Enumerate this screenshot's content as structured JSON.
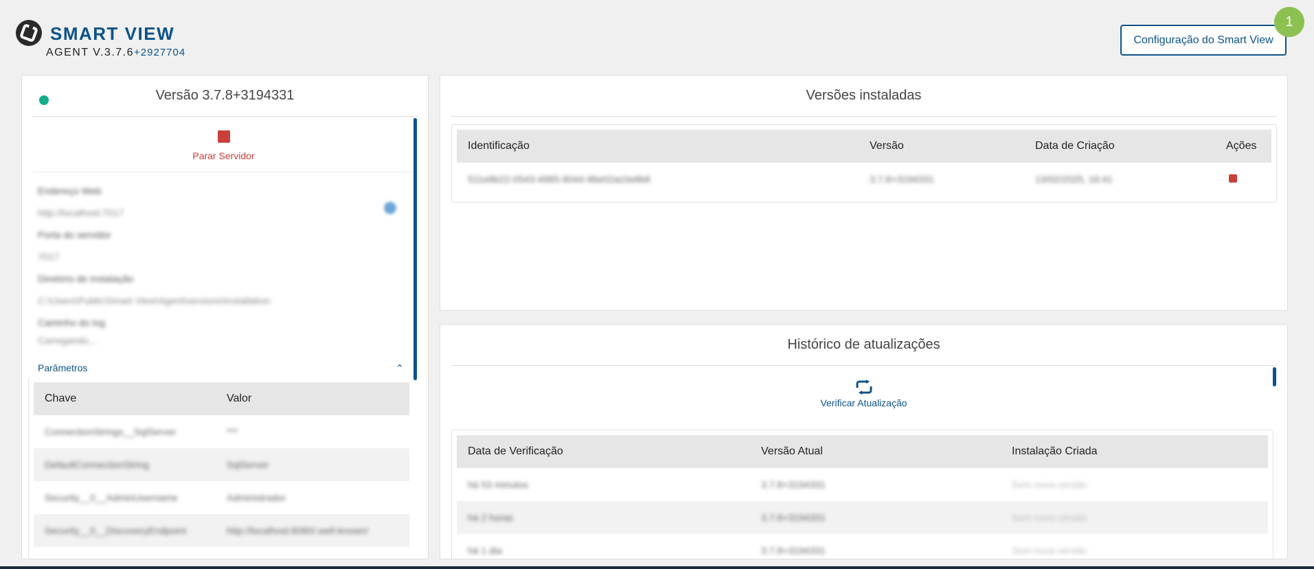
{
  "header": {
    "brand_title": "SMART VIEW",
    "agent_version": "AGENT V.3.7.6",
    "agent_build": "+2927704",
    "config_button": "Configuração do Smart View",
    "badge_count": "1"
  },
  "server": {
    "title": "Versão 3.7.8+3194331",
    "status_color": "#11ad8a",
    "stop_label": "Parar Servidor",
    "info_lines": [
      "Endereço Web",
      "http://localhost:7017",
      "Porta do servidor",
      "7017",
      "Diretório de instalação",
      "C:\\Users\\Public\\Smart View\\Agent\\versions\\installation",
      "Caminho do log",
      "Carregando..."
    ],
    "params_label": "Parâmetros",
    "params_table": {
      "headers": [
        "Chave",
        "Valor"
      ],
      "rows": [
        [
          "ConnectionStrings__SqlServer",
          "***"
        ],
        [
          "DefaultConnectionString",
          "SqlServer"
        ],
        [
          "Security__0__AdminUsername",
          "Administrador"
        ],
        [
          "Security__0__DiscoveryEndpoint",
          "http://localhost:8080/.well-known/"
        ]
      ]
    }
  },
  "versions": {
    "title": "Versões instaladas",
    "headers": [
      "Identificação",
      "Versão",
      "Data de Criação",
      "Ações"
    ],
    "rows": [
      [
        "511e8b22-0543-4985-9044-96e02ac0e8b6",
        "3.7.8+3194331",
        "13/02/2025, 16:41"
      ]
    ]
  },
  "history": {
    "title": "Histórico de atualizações",
    "check_label": "Verificar Atualização",
    "headers": [
      "Data de Verificação",
      "Versão Atual",
      "Instalação Criada"
    ],
    "rows": [
      [
        "há 53 minutos",
        "3.7.8+3194331",
        "Sem nova versão"
      ],
      [
        "há 2 horas",
        "3.7.8+3194331",
        "Sem nova versão"
      ],
      [
        "há 1 dia",
        "3.7.8+3194331",
        "Sem nova versão"
      ]
    ]
  },
  "colors": {
    "brand": "#0c5289",
    "danger": "#c9403a",
    "badge": "#8cc152"
  }
}
